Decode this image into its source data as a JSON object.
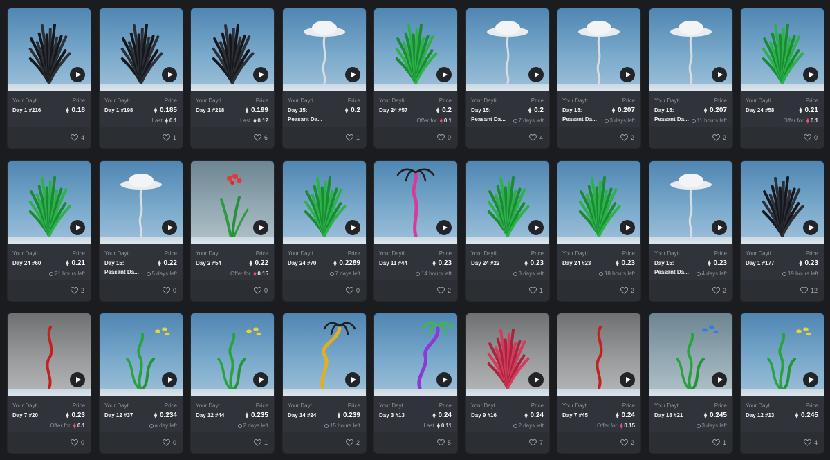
{
  "cards": [
    {
      "art": "dark",
      "coll": "Your Dayti...",
      "title": "Day 1 #216",
      "price_label": "Price",
      "price": "0.18",
      "sub_kind": "none",
      "sub_value": "",
      "likes": "4"
    },
    {
      "art": "dark",
      "coll": "Your Dayti...",
      "title": "Day 1 #198",
      "price_label": "Price",
      "price": "0.185",
      "sub_kind": "last",
      "sub_label": "Last",
      "sub_value": "0.1",
      "likes": "1"
    },
    {
      "art": "dark",
      "coll": "Your Dayti...",
      "title": "Day 1 #218",
      "price_label": "Price",
      "price": "0.199",
      "sub_kind": "last",
      "sub_label": "Last",
      "sub_value": "0.12",
      "likes": "6"
    },
    {
      "art": "ufo",
      "coll": "Your Dayti...",
      "title": "Day 15:",
      "title2": "Peasant Da...",
      "price_label": "Price",
      "price": "0.2",
      "sub_kind": "none",
      "sub_value": "",
      "likes": "1"
    },
    {
      "art": "green",
      "coll": "Your Dayti...",
      "title": "Day 24 #57",
      "price_label": "Price",
      "price": "0.2",
      "sub_kind": "offer",
      "sub_label": "Offer for",
      "sub_value": "0.1",
      "likes": "0"
    },
    {
      "art": "ufo",
      "coll": "Your Dayti...",
      "title": "Day 15:",
      "title2": "Peasant Da...",
      "price_label": "Price",
      "price": "0.2",
      "sub_kind": "time",
      "sub_value": "7 days left",
      "likes": "4"
    },
    {
      "art": "ufo",
      "coll": "Your Dayti...",
      "title": "Day 15:",
      "title2": "Peasant Da...",
      "price_label": "Price",
      "price": "0.207",
      "sub_kind": "time",
      "sub_value": "3 days left",
      "likes": "2"
    },
    {
      "art": "ufo",
      "coll": "Your Dayti...",
      "title": "Day 15:",
      "title2": "Peasant Da...",
      "price_label": "Price",
      "price": "0.207",
      "sub_kind": "time",
      "sub_value": "11 hours left",
      "likes": "2"
    },
    {
      "art": "green",
      "coll": "Your Dayti...",
      "title": "Day 24 #58",
      "price_label": "Price",
      "price": "0.21",
      "sub_kind": "offer",
      "sub_label": "Offer for",
      "sub_value": "0.1",
      "likes": "0"
    },
    {
      "art": "green",
      "coll": "Your Dayti...",
      "title": "Day 24 #60",
      "price_label": "Price",
      "price": "0.21",
      "sub_kind": "time",
      "sub_value": "21 hours left",
      "likes": "2"
    },
    {
      "art": "ufo",
      "coll": "Your Dayti...",
      "title": "Day 15:",
      "title2": "Peasant Da...",
      "price_label": "Price",
      "price": "0.22",
      "sub_kind": "time",
      "sub_value": "5 days left",
      "likes": "0"
    },
    {
      "art": "redflower",
      "coll": "Your Dayt...",
      "title": "Day 2 #54",
      "price_label": "Price",
      "price": "0.22",
      "sub_kind": "offer",
      "sub_label": "Offer for",
      "sub_value": "0.15",
      "likes": "0"
    },
    {
      "art": "green",
      "coll": "Your Dayti...",
      "title": "Day 24 #70",
      "price_label": "Price",
      "price": "0.2289",
      "sub_kind": "time",
      "sub_value": "7 days left",
      "likes": "0"
    },
    {
      "art": "palmpink",
      "coll": "Your Dayti...",
      "title": "Day 11 #44",
      "price_label": "Price",
      "price": "0.23",
      "sub_kind": "time",
      "sub_value": "14 hours left",
      "likes": "2"
    },
    {
      "art": "green",
      "coll": "Your Dayti...",
      "title": "Day 24 #22",
      "price_label": "Price",
      "price": "0.23",
      "sub_kind": "time",
      "sub_value": "3 days left",
      "likes": "1"
    },
    {
      "art": "green",
      "coll": "Your Dayti...",
      "title": "Day 24 #23",
      "price_label": "Price",
      "price": "0.23",
      "sub_kind": "time",
      "sub_value": "18 hours left",
      "likes": "2"
    },
    {
      "art": "ufo",
      "coll": "Your Dayti...",
      "title": "Day 15:",
      "title2": "Peasant Da...",
      "price_label": "Price",
      "price": "0.23",
      "sub_kind": "time",
      "sub_value": "4 days left",
      "likes": "2"
    },
    {
      "art": "dark",
      "coll": "Your Dayti...",
      "title": "Day 1 #177",
      "price_label": "Price",
      "price": "0.23",
      "sub_kind": "time",
      "sub_value": "19 hours left",
      "likes": "12"
    },
    {
      "art": "redthin",
      "coll": "Your Dayti...",
      "title": "Day 7 #20",
      "price_label": "Price",
      "price": "0.23",
      "sub_kind": "offer",
      "sub_label": "Offer for",
      "sub_value": "0.1",
      "likes": "0"
    },
    {
      "art": "yellowweed",
      "coll": "Your Dayt...",
      "title": "Day 12 #37",
      "price_label": "Price",
      "price": "0.234",
      "sub_kind": "time",
      "sub_value": "a day left",
      "likes": "0"
    },
    {
      "art": "yellowweed",
      "coll": "Your Dayt...",
      "title": "Day 12 #44",
      "price_label": "Price",
      "price": "0.235",
      "sub_kind": "time",
      "sub_value": "2 days left",
      "likes": "1"
    },
    {
      "art": "palmyellow",
      "coll": "Your Dayt...",
      "title": "Day 14 #24",
      "price_label": "Price",
      "price": "0.239",
      "sub_kind": "time",
      "sub_value": "15 hours left",
      "likes": "2"
    },
    {
      "art": "palmpurple",
      "coll": "Your Dayt...",
      "title": "Day 3 #13",
      "price_label": "Price",
      "price": "0.24",
      "sub_kind": "last",
      "sub_label": "Last",
      "sub_value": "0.11",
      "likes": "5"
    },
    {
      "art": "redbush",
      "coll": "Your Dayt...",
      "title": "Day 9 #16",
      "price_label": "Price",
      "price": "0.24",
      "sub_kind": "time",
      "sub_value": "2 days left",
      "likes": "7"
    },
    {
      "art": "redthin",
      "coll": "Your Dayt...",
      "title": "Day 7 #45",
      "price_label": "Price",
      "price": "0.24",
      "sub_kind": "offer",
      "sub_label": "Offer for",
      "sub_value": "0.15",
      "likes": "2"
    },
    {
      "art": "blueweed",
      "coll": "Your Dayt...",
      "title": "Day 18 #21",
      "price_label": "Price",
      "price": "0.245",
      "sub_kind": "time",
      "sub_value": "3 days left",
      "likes": "1"
    },
    {
      "art": "yellowweed",
      "coll": "Your Dayt...",
      "title": "Day 12 #13",
      "price_label": "Price",
      "price": "0.245",
      "sub_kind": "none",
      "sub_value": "",
      "likes": "4"
    }
  ]
}
